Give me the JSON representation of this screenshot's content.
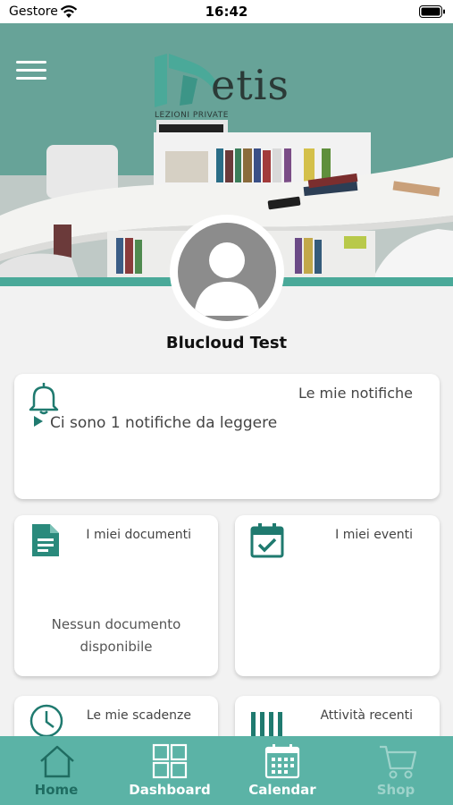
{
  "status_bar": {
    "carrier": "Gestore",
    "time": "16:42"
  },
  "header": {
    "logo_word": "etis",
    "logo_subtitle": "LEZIONI PRIVATE"
  },
  "profile": {
    "name": "Blucloud Test"
  },
  "notifications_card": {
    "title": "Le mie notifiche",
    "message": "Ci sono 1 notifiche da leggere"
  },
  "documents_card": {
    "title": "I miei documenti",
    "empty_line1": "Nessun documento",
    "empty_line2": "disponibile"
  },
  "events_card": {
    "title": "I miei eventi"
  },
  "deadlines_card": {
    "title": "Le mie scadenze"
  },
  "recent_card": {
    "title": "Attività recenti"
  },
  "tab_bar": {
    "tabs": [
      {
        "label": "Home",
        "icon": "home-icon",
        "state": "active"
      },
      {
        "label": "Dashboard",
        "icon": "dashboard-icon",
        "state": "normal"
      },
      {
        "label": "Calendar",
        "icon": "calendar-icon",
        "state": "normal"
      },
      {
        "label": "Shop",
        "icon": "cart-icon",
        "state": "disabled"
      }
    ]
  },
  "colors": {
    "accent": "#1f7a6f",
    "tab_bar": "#5bb3a6",
    "tab_active": "#1f6c61",
    "tab_disabled": "#9ed3cb",
    "stripe": "#4aa999"
  }
}
